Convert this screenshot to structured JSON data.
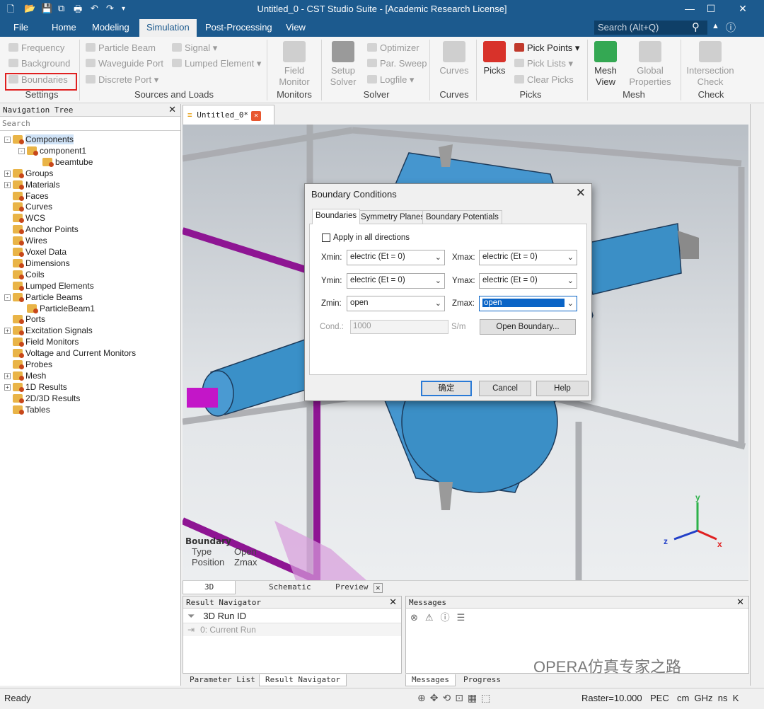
{
  "window": {
    "title": "Untitled_0 - CST Studio Suite - [Academic Research License]"
  },
  "ribbon_tabs": [
    "File",
    "Home",
    "Modeling",
    "Simulation",
    "Post-Processing",
    "View"
  ],
  "active_tab": "Simulation",
  "search_placeholder": "Search (Alt+Q)",
  "ribbon": {
    "settings": {
      "frequency": "Frequency",
      "background": "Background",
      "boundaries": "Boundaries",
      "group": "Settings"
    },
    "sources": {
      "particle_beam": "Particle Beam",
      "waveguide_port": "Waveguide Port",
      "discrete_port": "Discrete Port",
      "signal": "Signal",
      "lumped_element": "Lumped Element",
      "group": "Sources and Loads"
    },
    "monitors": {
      "field_monitor": "Field\nMonitor",
      "group": "Monitors"
    },
    "solver": {
      "setup_solver": "Setup\nSolver",
      "optimizer": "Optimizer",
      "par_sweep": "Par. Sweep",
      "logfile": "Logfile",
      "group": "Solver"
    },
    "curves": {
      "curves": "Curves",
      "group": "Curves"
    },
    "picks": {
      "picks": "Picks",
      "pick_points": "Pick Points",
      "pick_lists": "Pick Lists",
      "clear_picks": "Clear Picks",
      "group": "Picks"
    },
    "mesh": {
      "mesh_view": "Mesh\nView",
      "global_properties": "Global\nProperties",
      "group": "Mesh"
    },
    "check": {
      "intersection_check": "Intersection\nCheck",
      "group": "Check"
    }
  },
  "nav_tree": {
    "title": "Navigation Tree",
    "search": "Search",
    "items": [
      {
        "label": "Components",
        "level": 0,
        "expander": "-"
      },
      {
        "label": "component1",
        "level": 1,
        "expander": "-"
      },
      {
        "label": "beamtube",
        "level": 2,
        "expander": ""
      },
      {
        "label": "Groups",
        "level": 0,
        "expander": "+"
      },
      {
        "label": "Materials",
        "level": 0,
        "expander": "+"
      },
      {
        "label": "Faces",
        "level": 0,
        "expander": ""
      },
      {
        "label": "Curves",
        "level": 0,
        "expander": ""
      },
      {
        "label": "WCS",
        "level": 0,
        "expander": ""
      },
      {
        "label": "Anchor Points",
        "level": 0,
        "expander": ""
      },
      {
        "label": "Wires",
        "level": 0,
        "expander": ""
      },
      {
        "label": "Voxel Data",
        "level": 0,
        "expander": ""
      },
      {
        "label": "Dimensions",
        "level": 0,
        "expander": ""
      },
      {
        "label": "Coils",
        "level": 0,
        "expander": ""
      },
      {
        "label": "Lumped Elements",
        "level": 0,
        "expander": ""
      },
      {
        "label": "Particle Beams",
        "level": 0,
        "expander": "-"
      },
      {
        "label": "ParticleBeam1",
        "level": 1,
        "expander": ""
      },
      {
        "label": "Ports",
        "level": 0,
        "expander": ""
      },
      {
        "label": "Excitation Signals",
        "level": 0,
        "expander": "+"
      },
      {
        "label": "Field Monitors",
        "level": 0,
        "expander": ""
      },
      {
        "label": "Voltage and Current Monitors",
        "level": 0,
        "expander": ""
      },
      {
        "label": "Probes",
        "level": 0,
        "expander": ""
      },
      {
        "label": "Mesh",
        "level": 0,
        "expander": "+"
      },
      {
        "label": "1D Results",
        "level": 0,
        "expander": "+"
      },
      {
        "label": "2D/3D Results",
        "level": 0,
        "expander": ""
      },
      {
        "label": "Tables",
        "level": 0,
        "expander": ""
      }
    ]
  },
  "document_tab": "Untitled_0*",
  "viewport": {
    "boundary_info": {
      "heading": "Boundary",
      "type_label": "Type",
      "type_value": "Open",
      "position_label": "Position",
      "position_value": "Zmax"
    },
    "axes": {
      "x": "x",
      "y": "y",
      "z": "z"
    }
  },
  "view_tabs": [
    "3D",
    "Schematic",
    "Preview"
  ],
  "dialog": {
    "title": "Boundary Conditions",
    "tabs": [
      "Boundaries",
      "Symmetry Planes",
      "Boundary Potentials"
    ],
    "apply_all": "Apply in all directions",
    "xmin_label": "Xmin:",
    "xmin": "electric (Et = 0)",
    "xmax_label": "Xmax:",
    "xmax": "electric (Et = 0)",
    "ymin_label": "Ymin:",
    "ymin": "electric (Et = 0)",
    "ymax_label": "Ymax:",
    "ymax": "electric (Et = 0)",
    "zmin_label": "Zmin:",
    "zmin": "open",
    "zmax_label": "Zmax:",
    "zmax": "open",
    "cond_label": "Cond.:",
    "cond_value": "1000",
    "cond_unit": "S/m",
    "open_boundary": "Open Boundary...",
    "ok": "确定",
    "cancel": "Cancel",
    "help": "Help"
  },
  "result_navigator": {
    "title": "Result Navigator",
    "run_id": "3D Run ID",
    "current_run": "0: Current Run"
  },
  "left_bottom_tabs": [
    "Parameter List",
    "Result Navigator"
  ],
  "messages": {
    "title": "Messages"
  },
  "msg_tabs": [
    "Messages",
    "Progress"
  ],
  "status": {
    "ready": "Ready",
    "raster": "Raster=10.000",
    "pec": "PEC",
    "units": "cm  GHz  ns  K"
  },
  "watermark": "OPERA仿真专家之路"
}
